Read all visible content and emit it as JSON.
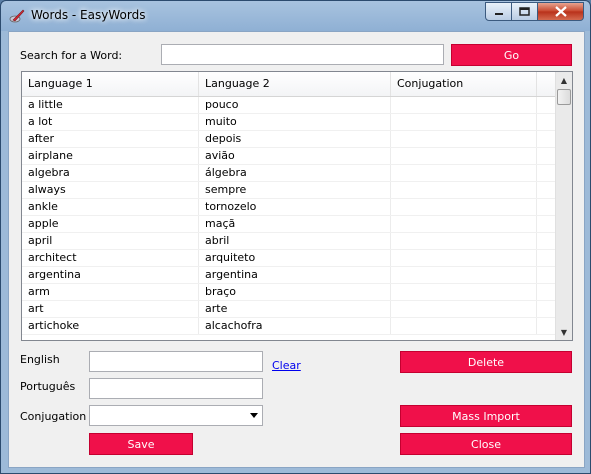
{
  "window": {
    "title": "Words - EasyWords"
  },
  "search": {
    "label": "Search for a Word:",
    "value": "",
    "go_label": "Go"
  },
  "table": {
    "columns": [
      "Language 1",
      "Language 2",
      "Conjugation"
    ],
    "rows": [
      [
        "a little",
        "pouco",
        ""
      ],
      [
        "a lot",
        "muito",
        ""
      ],
      [
        "after",
        "depois",
        ""
      ],
      [
        "airplane",
        "avião",
        ""
      ],
      [
        "algebra",
        "álgebra",
        ""
      ],
      [
        "always",
        "sempre",
        ""
      ],
      [
        "ankle",
        "tornozelo",
        ""
      ],
      [
        "apple",
        "maçã",
        ""
      ],
      [
        "april",
        "abril",
        ""
      ],
      [
        "architect",
        "arquiteto",
        ""
      ],
      [
        "argentina",
        "argentina",
        ""
      ],
      [
        "arm",
        "braço",
        ""
      ],
      [
        "art",
        "arte",
        ""
      ],
      [
        "artichoke",
        "alcachofra",
        ""
      ]
    ]
  },
  "form": {
    "english_label": "English",
    "english_value": "",
    "clear_label": "Clear",
    "portugues_label": "Português",
    "portugues_value": "",
    "conjugation_label": "Conjugation",
    "conjugation_value": ""
  },
  "buttons": {
    "delete": "Delete",
    "mass_import": "Mass Import",
    "save": "Save",
    "close": "Close"
  },
  "colors": {
    "accent": "#f0104a",
    "link": "#0000ee"
  }
}
